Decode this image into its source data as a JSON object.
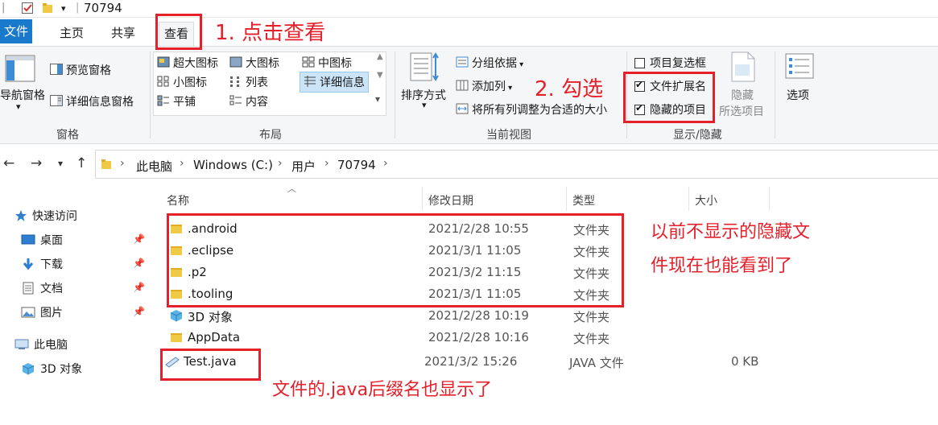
{
  "window": {
    "title": "70794"
  },
  "tabs": [
    {
      "label": "文件"
    },
    {
      "label": "主页"
    },
    {
      "label": "共享"
    },
    {
      "label": "查看"
    }
  ],
  "ribbon": {
    "panes": {
      "nav_pane": "导航窗格",
      "preview_pane": "预览窗格",
      "details_pane": "详细信息窗格",
      "group_label": "窗格"
    },
    "layout": {
      "items": [
        "超大图标",
        "大图标",
        "中图标",
        "小图标",
        "列表",
        "详细信息",
        "平铺",
        "内容"
      ],
      "selected": "详细信息",
      "group_label": "布局"
    },
    "current_view": {
      "sort_by": "排序方式",
      "group_by": "分组依据",
      "add_columns": "添加列",
      "size_columns": "将所有列调整为合适的大小",
      "group_label": "当前视图"
    },
    "show_hide": {
      "item_checkboxes": "项目复选框",
      "file_extensions": "文件扩展名",
      "hidden_items": "隐藏的项目",
      "hide_selected_1": "隐藏",
      "hide_selected_2": "所选项目",
      "group_label": "显示/隐藏",
      "item_checkboxes_checked": false,
      "file_extensions_checked": true,
      "hidden_items_checked": true
    },
    "options": "选项"
  },
  "address": {
    "crumbs": [
      "此电脑",
      "Windows (C:)",
      "用户",
      "70794"
    ]
  },
  "nav_pane": {
    "quick_access": "快速访问",
    "items": [
      {
        "label": "桌面"
      },
      {
        "label": "下载"
      },
      {
        "label": "文档"
      },
      {
        "label": "图片"
      }
    ],
    "this_pc": "此电脑",
    "objects_3d": "3D 对象"
  },
  "columns": {
    "name": "名称",
    "modified": "修改日期",
    "type": "类型",
    "size": "大小"
  },
  "files": [
    {
      "name": ".android",
      "modified": "2021/2/28 10:55",
      "type": "文件夹",
      "size": ""
    },
    {
      "name": ".eclipse",
      "modified": "2021/3/1 11:05",
      "type": "文件夹",
      "size": ""
    },
    {
      "name": ".p2",
      "modified": "2021/3/2 11:15",
      "type": "文件夹",
      "size": ""
    },
    {
      "name": ".tooling",
      "modified": "2021/3/1 11:05",
      "type": "文件夹",
      "size": ""
    },
    {
      "name": "3D 对象",
      "modified": "2021/2/28 10:19",
      "type": "文件夹",
      "size": ""
    },
    {
      "name": "AppData",
      "modified": "2021/2/28 10:16",
      "type": "文件夹",
      "size": ""
    },
    {
      "name": "Test.java",
      "modified": "2021/3/2 15:26",
      "type": "JAVA 文件",
      "size": "0 KB"
    }
  ],
  "annotations": {
    "step1": "1. 点击查看",
    "step2": "2. 勾选",
    "hidden_note_1": "以前不显示的隐藏文",
    "hidden_note_2": "件现在也能看到了",
    "ext_note": "文件的.java后缀名也显示了"
  },
  "colors": {
    "accent": "#1979ca",
    "annotation": "#e5202a",
    "folder": "#f0c945"
  }
}
